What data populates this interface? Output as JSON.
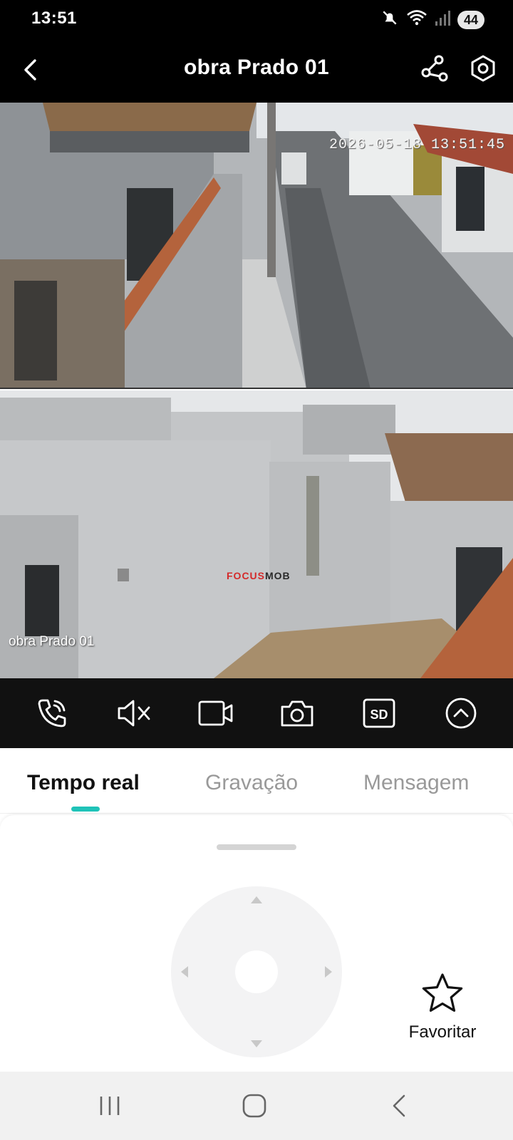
{
  "status_bar": {
    "time": "13:51",
    "battery": "44"
  },
  "header": {
    "title": "obra Prado 01"
  },
  "video": {
    "top_timestamp": "2026-05-18 13:51:45",
    "bottom_camera_name": "obra Prado 01",
    "watermark_part1": "FOCUS",
    "watermark_part2": "MOB"
  },
  "controls": {
    "icons": [
      "phone-call-icon",
      "mute-icon",
      "record-video-icon",
      "snapshot-camera-icon",
      "sd-card-icon",
      "expand-up-icon"
    ]
  },
  "tabs": [
    {
      "label": "Tempo real",
      "active": true
    },
    {
      "label": "Gravação",
      "active": false
    },
    {
      "label": "Mensagem",
      "active": false
    }
  ],
  "panel": {
    "favorite_label": "Favoritar"
  },
  "colors": {
    "accent": "#1fc3b8",
    "header_bg": "#000000",
    "controls_bg": "#111111"
  }
}
